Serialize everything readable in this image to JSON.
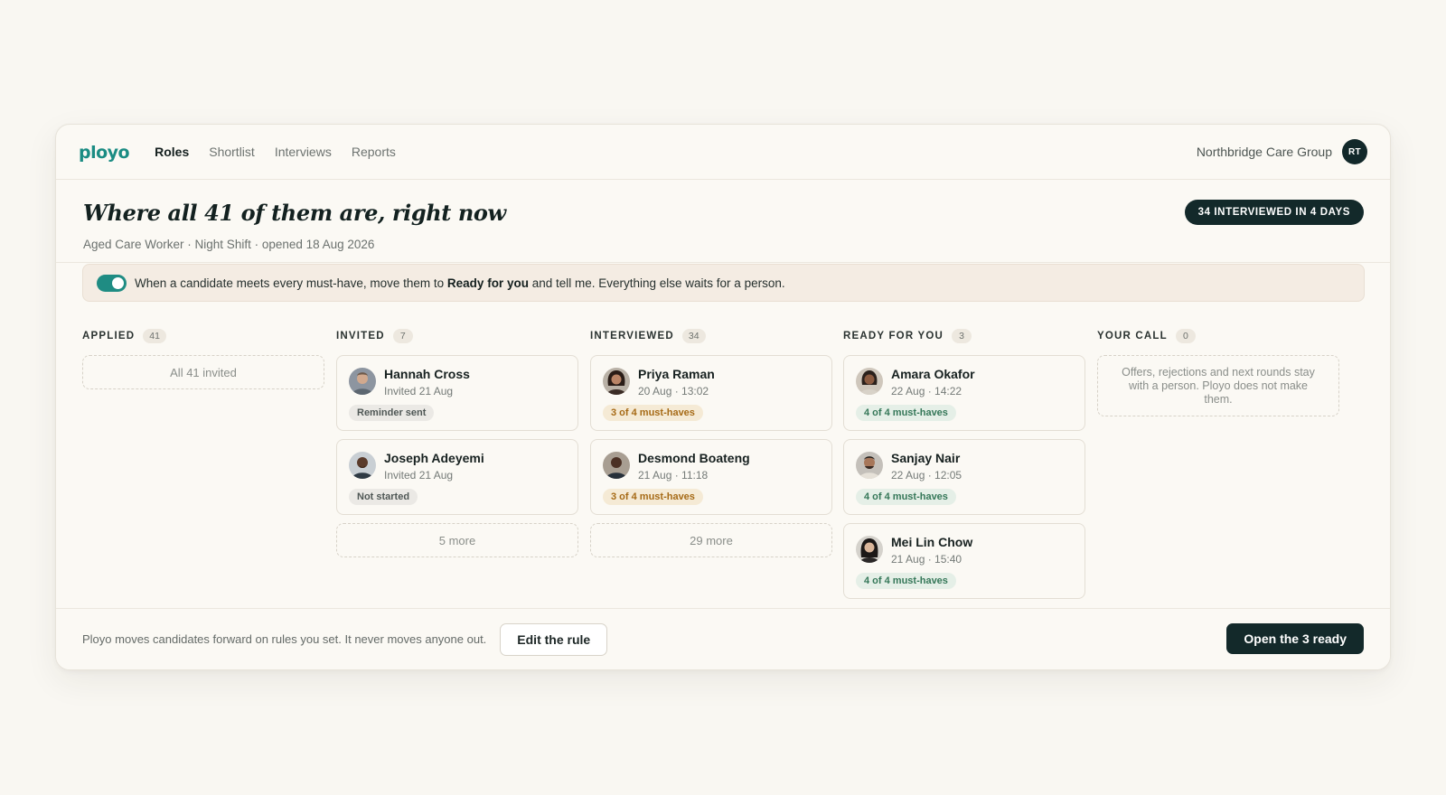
{
  "brand": {
    "logo": "ployo",
    "color": "#1b8c83"
  },
  "nav": {
    "links": [
      {
        "label": "Roles",
        "active": true
      },
      {
        "label": "Shortlist",
        "active": false
      },
      {
        "label": "Interviews",
        "active": false
      },
      {
        "label": "Reports",
        "active": false
      }
    ],
    "org": "Northbridge Care Group",
    "avatar_initials": "RT"
  },
  "header": {
    "title": "Where all 41 of them are, right now",
    "subtitle": "Aged Care Worker · Night Shift · opened 18 Aug 2026",
    "badge": "34 INTERVIEWED IN 4 DAYS"
  },
  "rule": {
    "enabled": true,
    "text_before": "When a candidate meets every must-have, move them to ",
    "text_bold": "Ready for you",
    "text_after": " and tell me. Everything else waits for a person."
  },
  "columns": {
    "applied": {
      "title": "APPLIED",
      "count": "41",
      "placeholder": "All 41 invited"
    },
    "invited": {
      "title": "INVITED",
      "count": "7",
      "cards": [
        {
          "name": "Hannah Cross",
          "meta": "Invited 21 Aug",
          "tag": "Reminder sent",
          "tag_style": "grey",
          "icon": "avatar-photo"
        },
        {
          "name": "Joseph Adeyemi",
          "meta": "Invited 21 Aug",
          "tag": "Not started",
          "tag_style": "grey",
          "icon": "avatar-photo"
        }
      ],
      "more": "5 more"
    },
    "interviewed": {
      "title": "INTERVIEWED",
      "count": "34",
      "cards": [
        {
          "name": "Priya Raman",
          "meta": "20 Aug · 13:02",
          "tag": "3 of 4 must-haves",
          "tag_style": "amber",
          "icon": "avatar-photo"
        },
        {
          "name": "Desmond Boateng",
          "meta": "21 Aug · 11:18",
          "tag": "3 of 4 must-haves",
          "tag_style": "amber",
          "icon": "avatar-photo"
        }
      ],
      "more": "29 more"
    },
    "ready": {
      "title": "READY FOR YOU",
      "count": "3",
      "cards": [
        {
          "name": "Amara Okafor",
          "meta": "22 Aug · 14:22",
          "tag": "4 of 4 must-haves",
          "tag_style": "green",
          "icon": "avatar-photo"
        },
        {
          "name": "Sanjay Nair",
          "meta": "22 Aug · 12:05",
          "tag": "4 of 4 must-haves",
          "tag_style": "green",
          "icon": "avatar-photo"
        },
        {
          "name": "Mei Lin Chow",
          "meta": "21 Aug · 15:40",
          "tag": "4 of 4 must-haves",
          "tag_style": "green",
          "icon": "avatar-photo"
        }
      ]
    },
    "your_call": {
      "title": "YOUR CALL",
      "count": "0",
      "placeholder": "Offers, rejections and next rounds stay with a person. Ployo does not make them."
    }
  },
  "footer": {
    "text": "Ployo moves candidates forward on rules you set. It never moves anyone out.",
    "edit_button": "Edit the rule",
    "open_button": "Open the 3 ready"
  },
  "colors": {
    "accent": "#1f8c83",
    "dark": "#13292a",
    "amber": "#a66a16",
    "green": "#357758"
  }
}
